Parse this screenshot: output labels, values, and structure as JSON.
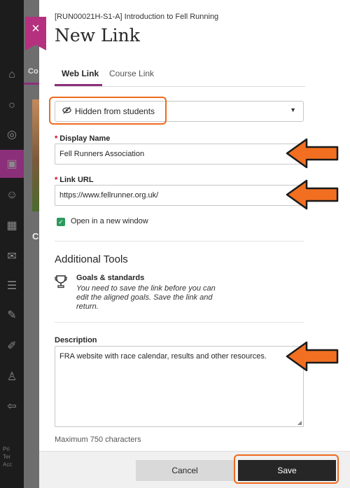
{
  "background": {
    "tab_stub": "Co",
    "c_stub": "C",
    "footer_text": "Pri\nTer\nAcc"
  },
  "panel": {
    "close_label": "×",
    "breadcrumb": "[RUN00021H-S1-A] Introduction to Fell Running",
    "title": "New Link"
  },
  "tabs": [
    {
      "label": "Web Link"
    },
    {
      "label": "Course Link"
    }
  ],
  "visibility": {
    "icon": "eye-slash-icon",
    "label": "Hidden from students"
  },
  "display_name": {
    "label": "Display Name",
    "value": "Fell Runners Association"
  },
  "link_url": {
    "label": "Link URL",
    "value": "https://www.fellrunner.org.uk/"
  },
  "new_window": {
    "label": "Open in a new window",
    "checked": true
  },
  "additional_tools": {
    "title": "Additional Tools",
    "goals_title": "Goals & standards",
    "goals_desc": "You need to save the link before you can edit the aligned goals. Save the link and return."
  },
  "description": {
    "label": "Description",
    "value": "FRA website with race calendar, results and other resources.",
    "max": "Maximum 750 characters"
  },
  "buttons": {
    "cancel": "Cancel",
    "save": "Save"
  },
  "colors": {
    "accent": "#8c2f7a",
    "highlight": "#ee6a1f",
    "check": "#2d9a5c"
  }
}
